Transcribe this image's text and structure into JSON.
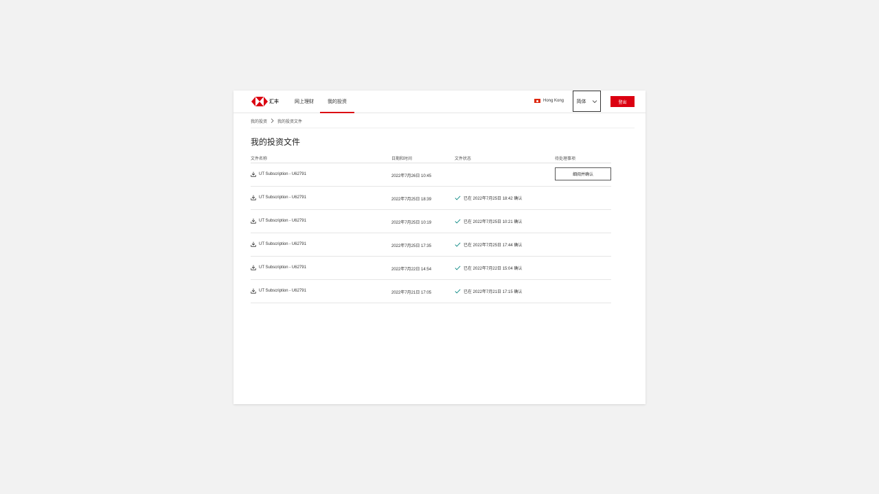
{
  "header": {
    "brand": "汇丰",
    "nav": [
      "网上理财",
      "我的投资"
    ],
    "region": "Hong Kong",
    "language": "简体",
    "logout": "登出",
    "colors": {
      "accent": "#db0011"
    }
  },
  "breadcrumb": [
    "我的投资",
    "我的投资文件"
  ],
  "page_title": "我的投资文件",
  "table": {
    "headers": [
      "文件名称",
      "日期和时间",
      "文件状态",
      "待处理事项"
    ],
    "rows": [
      {
        "name": "UT Subscription - U62791",
        "datetime": "2022年7月26日 10:45",
        "status": "",
        "action": "细阅并确认"
      },
      {
        "name": "UT Subscription - U62791",
        "datetime": "2022年7月25日 18:39",
        "status": "已在 2022年7月25日 18:42 确认",
        "action": ""
      },
      {
        "name": "UT Subscription - U62791",
        "datetime": "2022年7月25日 10:19",
        "status": "已在 2022年7月25日 10:21 确认",
        "action": ""
      },
      {
        "name": "UT Subscription - U62791",
        "datetime": "2022年7月25日 17:35",
        "status": "已在 2022年7月25日 17:44 确认",
        "action": ""
      },
      {
        "name": "UT Subscription - U62791",
        "datetime": "2022年7月22日 14:54",
        "status": "已在 2022年7月22日 15:04 确认",
        "action": ""
      },
      {
        "name": "UT Subscription - U62791",
        "datetime": "2022年7月21日 17:05",
        "status": "已在 2022年7月21日 17:15 确认",
        "action": ""
      }
    ]
  }
}
